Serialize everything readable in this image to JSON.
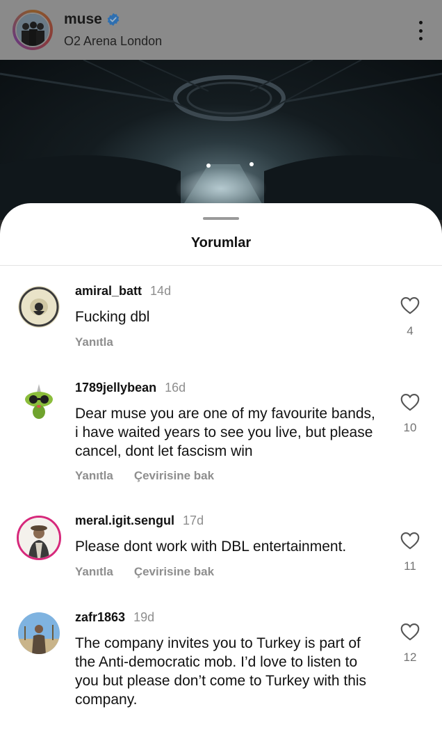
{
  "post": {
    "username": "muse",
    "location": "O2 Arena London"
  },
  "sheet": {
    "title": "Yorumlar"
  },
  "comments": [
    {
      "username": "amiral_batt",
      "time": "14d",
      "text": "Fucking dbl",
      "actions": [
        "Yanıtla"
      ],
      "likes": "4"
    },
    {
      "username": "1789jellybean",
      "time": "16d",
      "text": "Dear muse you are one of my favourite bands, i have waited years to see you live, but please cancel, dont let fascism win",
      "actions": [
        "Yanıtla",
        "Çevirisine bak"
      ],
      "likes": "10"
    },
    {
      "username": "meral.igit.sengul",
      "time": "17d",
      "text": "Please dont work with DBL entertainment.",
      "actions": [
        "Yanıtla",
        "Çevirisine bak"
      ],
      "likes": "11"
    },
    {
      "username": "zafr1863",
      "time": "19d",
      "text": "The company invites you to Turkey is part of the Anti-democratic mob. I’d love to listen to you but please don’t come to Turkey with this company.",
      "actions": [],
      "likes": "12"
    }
  ],
  "colors": {
    "verified": "#3897f0",
    "secondary_text": "#8e8e8e"
  },
  "icons": [
    "verified-badge-icon",
    "more-options-icon",
    "heart-icon"
  ]
}
